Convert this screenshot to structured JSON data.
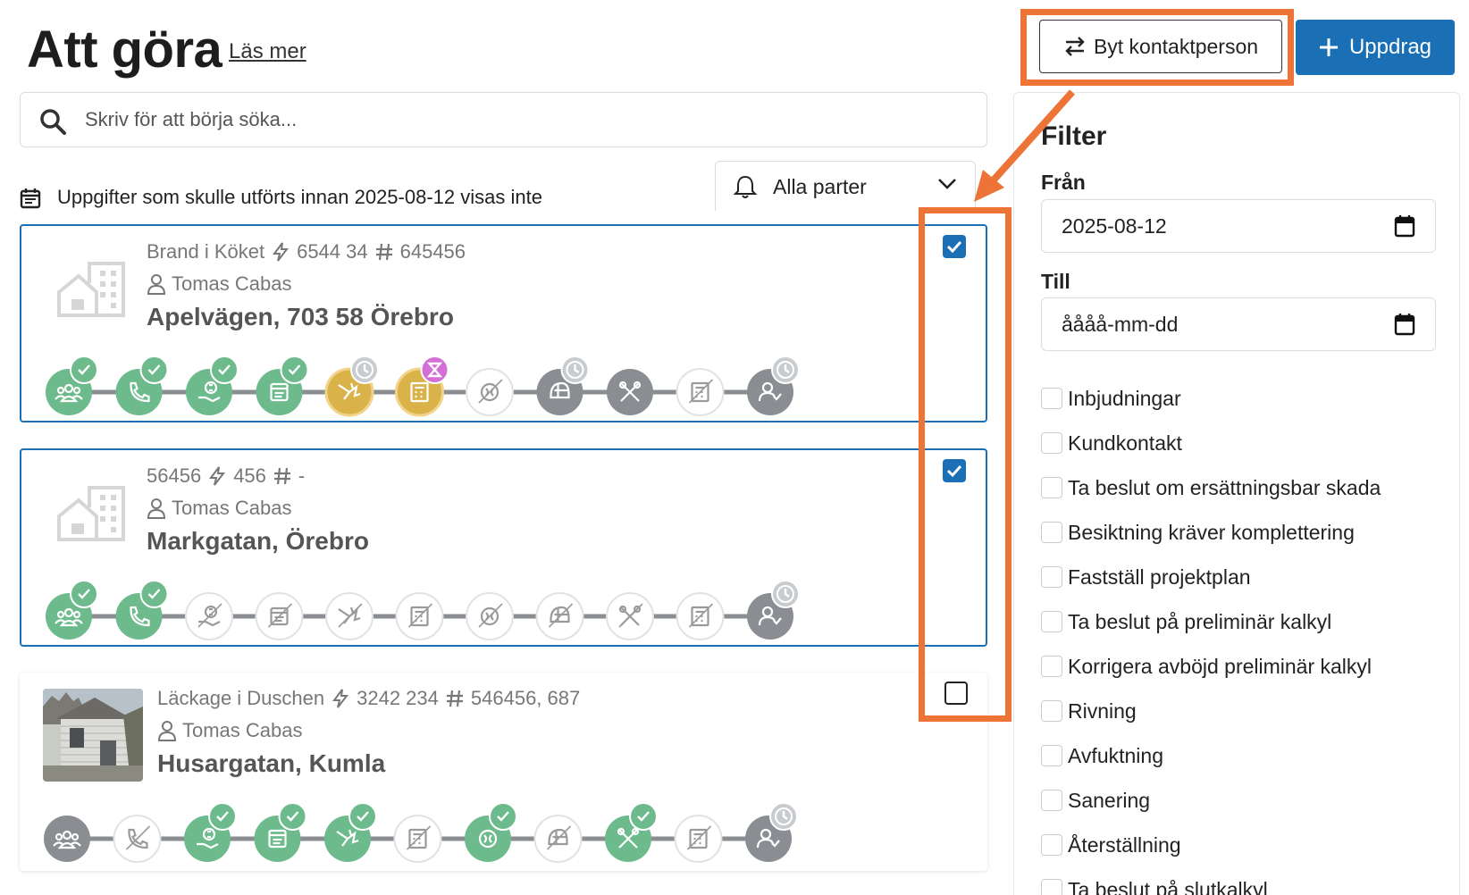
{
  "header": {
    "title": "Att göra",
    "read_more": "Läs mer",
    "switch_contact_label": "Byt kontaktperson",
    "new_assignment_label": "Uppdrag"
  },
  "search": {
    "placeholder": "Skriv för att börja söka..."
  },
  "notice": {
    "text": "Uppgifter som skulle utförts innan 2025-08-12 visas inte"
  },
  "party_filter": {
    "selected": "Alla parter"
  },
  "cards": [
    {
      "title": "Brand i Köket",
      "job_number": "6544 34",
      "ref": "645456",
      "person": "Tomas Cabas",
      "address": "Apelvägen, 703 58 Örebro",
      "checked": true,
      "image": "building-placeholder-icon"
    },
    {
      "title": "56456",
      "job_number": "456",
      "ref": "-",
      "person": "Tomas Cabas",
      "address": "Markgatan, Örebro",
      "checked": true,
      "image": "building-placeholder-icon"
    },
    {
      "title": "Läckage i Duschen",
      "job_number": "3242 234",
      "ref": "546456, 687",
      "person": "Tomas Cabas",
      "address": "Husargatan, Kumla",
      "checked": false,
      "image": "house-photo"
    }
  ],
  "filter": {
    "heading": "Filter",
    "from_label": "Från",
    "from_value": "2025-08-12",
    "to_label": "Till",
    "to_value": "åååå-mm-dd",
    "options": [
      "Inbjudningar",
      "Kundkontakt",
      "Ta beslut om ersättningsbar skada",
      "Besiktning kräver komplettering",
      "Fastställ projektplan",
      "Ta beslut på preliminär kalkyl",
      "Korrigera avböjd preliminär kalkyl",
      "Rivning",
      "Avfuktning",
      "Sanering",
      "Återställning",
      "Ta beslut på slutkalkyl"
    ]
  },
  "colors": {
    "primary": "#1a6fb5",
    "done": "#6dbb8d",
    "pending": "#d9b24a",
    "inactive": "#8a8d91",
    "annotation": "#ed7436",
    "badge_hourglass": "#d46fd6"
  }
}
